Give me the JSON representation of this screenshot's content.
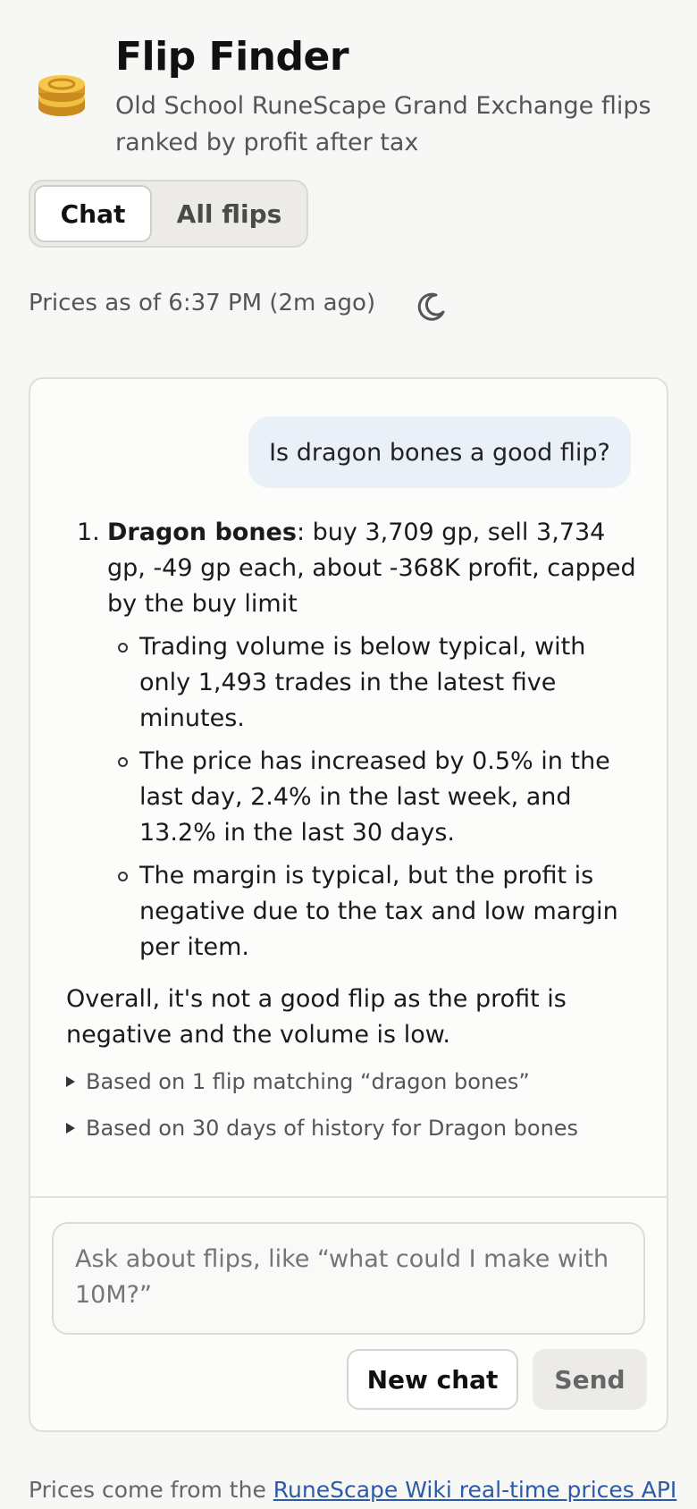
{
  "header": {
    "title": "Flip Finder",
    "subtitle": "Old School RuneScape Grand Exchange flips ranked by profit after tax",
    "icon": "coins-icon"
  },
  "tabs": [
    {
      "label": "Chat",
      "active": true
    },
    {
      "label": "All flips",
      "active": false
    }
  ],
  "status": {
    "prices_text": "Prices as of 6:37 PM (2m ago)",
    "theme_icon": "moon-icon"
  },
  "chat": {
    "user_message": "Is dragon bones a good flip?",
    "answer": {
      "item_number": "1.",
      "item_name": "Dragon bones",
      "item_text": ": buy 3,709 gp, sell 3,734 gp, -49 gp each, about -368K profit, capped by the buy limit",
      "bullets": [
        "Trading volume is below typical, with only 1,493 trades in the latest five minutes.",
        "The price has increased by 0.5% in the last day, 2.4% in the last week, and 13.2% in the last 30 days.",
        "The margin is typical, but the profit is negative due to the tax and low margin per item."
      ],
      "overall": "Overall, it's not a good flip as the profit is negative and the volume is low."
    },
    "details": [
      "Based on 1 flip matching “dragon bones”",
      "Based on 30 days of history for Dragon bones"
    ],
    "input_placeholder": "Ask about flips, like “what could I make with 10M?”",
    "new_chat_label": "New chat",
    "send_label": "Send"
  },
  "footer": {
    "prefix": "Prices come from the ",
    "link_text": "RuneScape Wiki real-time prices API"
  },
  "colors": {
    "accent_link": "#2b5aa8",
    "user_bubble": "#eaf0f8",
    "coin_gold": "#e8b53a"
  }
}
